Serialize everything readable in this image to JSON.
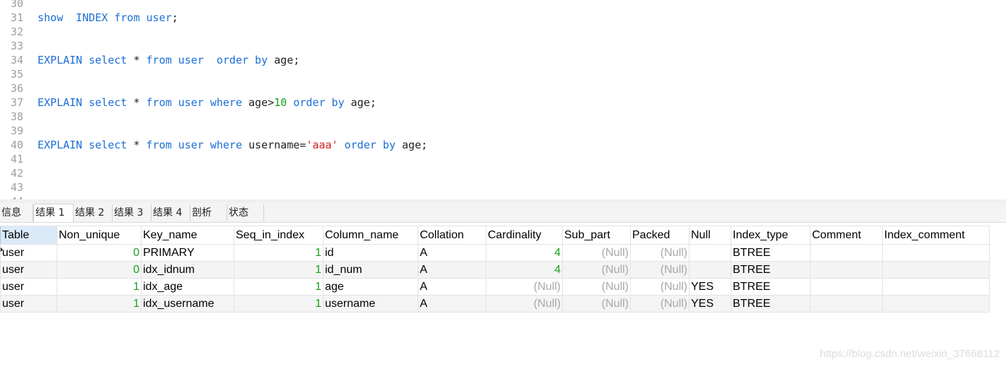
{
  "editor": {
    "lines": [
      {
        "num": "30",
        "tokens": []
      },
      {
        "num": "31",
        "tokens": [
          {
            "t": "kw",
            "v": "show  INDEX from user"
          },
          {
            "t": "id",
            "v": ";"
          }
        ]
      },
      {
        "num": "32",
        "tokens": []
      },
      {
        "num": "33",
        "tokens": []
      },
      {
        "num": "34",
        "tokens": [
          {
            "t": "kw",
            "v": "EXPLAIN select"
          },
          {
            "t": "id",
            "v": " * "
          },
          {
            "t": "kw",
            "v": "from user  order by"
          },
          {
            "t": "id",
            "v": " age;"
          }
        ]
      },
      {
        "num": "35",
        "tokens": []
      },
      {
        "num": "36",
        "tokens": []
      },
      {
        "num": "37",
        "tokens": [
          {
            "t": "kw",
            "v": "EXPLAIN select"
          },
          {
            "t": "id",
            "v": " * "
          },
          {
            "t": "kw",
            "v": "from user where"
          },
          {
            "t": "id",
            "v": " age>"
          },
          {
            "t": "num",
            "v": "10"
          },
          {
            "t": "kw",
            "v": " order by"
          },
          {
            "t": "id",
            "v": " age;"
          }
        ]
      },
      {
        "num": "38",
        "tokens": []
      },
      {
        "num": "39",
        "tokens": []
      },
      {
        "num": "40",
        "tokens": [
          {
            "t": "kw",
            "v": "EXPLAIN select"
          },
          {
            "t": "id",
            "v": " * "
          },
          {
            "t": "kw",
            "v": "from user where"
          },
          {
            "t": "id",
            "v": " username="
          },
          {
            "t": "str",
            "v": "'aaa'"
          },
          {
            "t": "kw",
            "v": " order by"
          },
          {
            "t": "id",
            "v": " age;"
          }
        ]
      },
      {
        "num": "41",
        "tokens": []
      },
      {
        "num": "42",
        "tokens": []
      },
      {
        "num": "43",
        "tokens": []
      },
      {
        "num": "44",
        "tokens": []
      }
    ]
  },
  "tabs": [
    {
      "label": "信息",
      "active": false
    },
    {
      "label": "结果 1",
      "active": true
    },
    {
      "label": "结果 2",
      "active": false
    },
    {
      "label": "结果 3",
      "active": false
    },
    {
      "label": "结果 4",
      "active": false
    },
    {
      "label": "剖析",
      "active": false
    },
    {
      "label": "状态",
      "active": false
    }
  ],
  "grid": {
    "columns": [
      "Table",
      "Non_unique",
      "Key_name",
      "Seq_in_index",
      "Column_name",
      "Collation",
      "Cardinality",
      "Sub_part",
      "Packed",
      "Null",
      "Index_type",
      "Comment",
      "Index_comment"
    ],
    "rows": [
      [
        "user",
        "0",
        "PRIMARY",
        "1",
        "id",
        "A",
        "4",
        "(Null)",
        "(Null)",
        "",
        "BTREE",
        "",
        ""
      ],
      [
        "user",
        "0",
        "idx_idnum",
        "1",
        "id_num",
        "A",
        "4",
        "(Null)",
        "(Null)",
        "",
        "BTREE",
        "",
        ""
      ],
      [
        "user",
        "1",
        "idx_age",
        "1",
        "age",
        "A",
        "(Null)",
        "(Null)",
        "(Null)",
        "YES",
        "BTREE",
        "",
        ""
      ],
      [
        "user",
        "1",
        "idx_username",
        "1",
        "username",
        "A",
        "(Null)",
        "(Null)",
        "(Null)",
        "YES",
        "BTREE",
        "",
        ""
      ]
    ],
    "null_text": "(Null)"
  },
  "watermark": "https://blog.csdn.net/weixin_37668112",
  "colors": {
    "keyword": "#1c6ed6",
    "number": "#19a01d",
    "string": "#d51d1d",
    "null": "#a8a8a8",
    "selected_header": "#dbeaf8"
  }
}
